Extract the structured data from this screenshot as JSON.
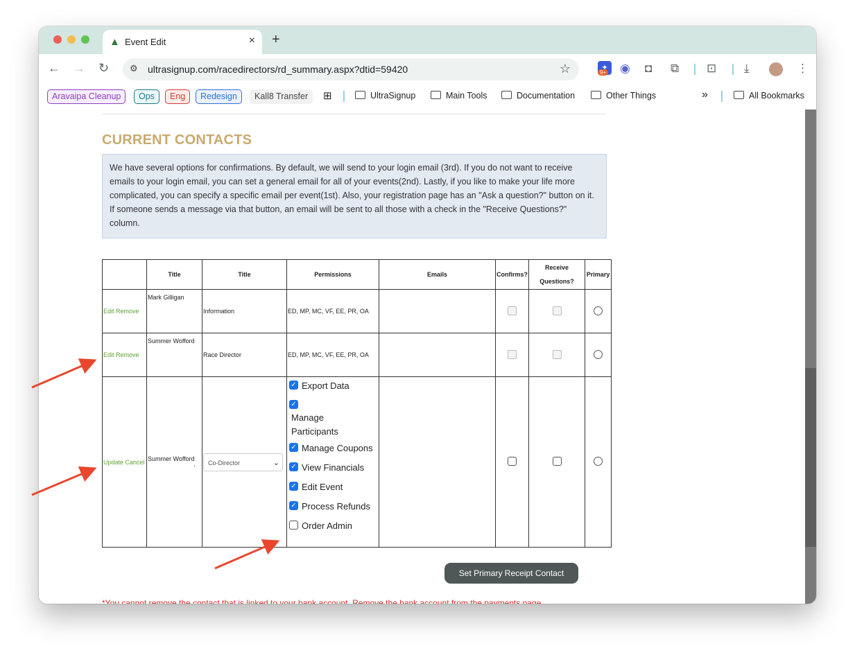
{
  "browser": {
    "tab_title": "Event Edit",
    "url": "ultrasignup.com/racedirectors/rd_summary.aspx?dtid=59420",
    "extension_badge_count": "9+",
    "bookmarks_bar": {
      "chips": [
        {
          "label": "Aravaipa Cleanup",
          "color": "#8e3fbf"
        },
        {
          "label": "Ops",
          "color": "#1f7a8c"
        },
        {
          "label": "Eng",
          "color": "#d13a2f"
        },
        {
          "label": "Redesign",
          "color": "#2f6fd1"
        },
        {
          "label": "Kall8 Transfer",
          "color": "#555555"
        }
      ],
      "folders": [
        "UltraSignup",
        "Main Tools",
        "Documentation",
        "Other Things"
      ],
      "overflow": "»",
      "all_bookmarks": "All Bookmarks"
    }
  },
  "page": {
    "heading": "CURRENT CONTACTS",
    "info_text": "We have several options for confirmations. By default, we will send to your login email (3rd). If you do not want to receive emails to your login email, you can set a general email for all of your events(2nd). Lastly, if you like to make your life more complicated, you can specify a specific email per event(1st). Also, your registration page has an \"Ask a question?\" button on it. If someone sends a message via that button, an email will be sent to all those with a check in the \"Receive Questions?\" column.",
    "table": {
      "headers": [
        "",
        "Title",
        "Title",
        "Permissions",
        "Emails",
        "Confirms?",
        "Receive Questions?",
        "Primary"
      ],
      "rows": [
        {
          "actions": "Edit Remove",
          "name": "Mark Gilligan",
          "title": "Information",
          "permissions": "ED, MP, MC, VF, EE, PR, OA"
        },
        {
          "actions": "Edit Remove",
          "name": "Summer Wofford",
          "title": "Race Director",
          "permissions": "ED, MP, MC, VF, EE, PR, OA"
        }
      ],
      "edit_row": {
        "actions": "Update Cancel",
        "name": "Summer Wofford",
        "dot": "·",
        "title_select": "Co-Director",
        "permissions": [
          {
            "label": "Export Data",
            "checked": true
          },
          {
            "label": "Manage Participants",
            "checked": true
          },
          {
            "label": "Manage Coupons",
            "checked": true
          },
          {
            "label": "View Financials",
            "checked": true
          },
          {
            "label": "Edit Event",
            "checked": true
          },
          {
            "label": "Process Refunds",
            "checked": true
          },
          {
            "label": "Order Admin",
            "checked": false
          }
        ]
      }
    },
    "primary_button": "Set Primary Receipt Contact",
    "warning": "*You cannot remove the contact that is linked to your bank account. Remove the bank account from the payments page"
  }
}
